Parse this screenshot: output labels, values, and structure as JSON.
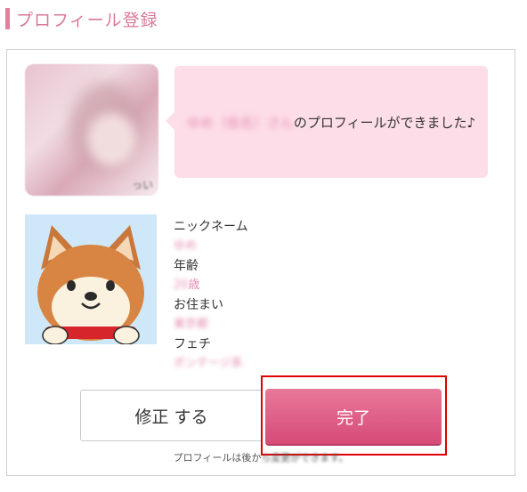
{
  "header": {
    "title": "プロフィール登録"
  },
  "bubble": {
    "name": "ゆめ（仮名）さん",
    "message": "のプロフィールができました♪"
  },
  "photo": {
    "corner_text": "っい"
  },
  "profile": {
    "nickname_label": "ニックネーム",
    "nickname_value": "ゆめ",
    "age_label": "年齢",
    "age_value": "20",
    "age_unit": "歳",
    "residence_label": "お住まい",
    "residence_value": "東京都",
    "fetish_label": "フェチ",
    "fetish_value": "ボンテージ系"
  },
  "buttons": {
    "edit_label": "修正 する",
    "done_label": "完了"
  },
  "note": {
    "visible": "プロフィールは後か",
    "blurred": "ら変更ができます。"
  },
  "colors": {
    "accent": "#e0829c",
    "bubble": "#fddde8",
    "done_button": "#d9567f",
    "highlight_border": "#e00000"
  }
}
